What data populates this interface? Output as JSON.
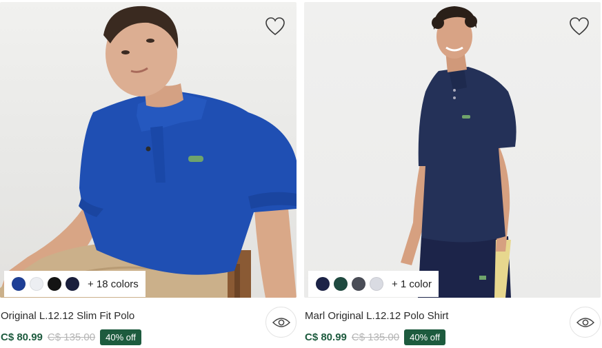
{
  "products": [
    {
      "name": "Original L.12.12 Slim Fit Polo",
      "price": "C$ 80.99",
      "original_price": "C$ 135.00",
      "discount_badge": "40% off",
      "more_colors": "+ 18 colors",
      "swatches": [
        "#1e3f96",
        "#eceef2",
        "#141414",
        "#1a1f3d"
      ],
      "shirt_color": "#1f4fb3"
    },
    {
      "name": "Marl Original L.12.12 Polo Shirt",
      "price": "C$ 80.99",
      "original_price": "C$ 135.00",
      "discount_badge": "40% off",
      "more_colors": "+ 1 color",
      "swatches": [
        "#1c2347",
        "#1f4a40",
        "#4a4d57",
        "#d9dbe2"
      ],
      "shirt_color": "#243158"
    }
  ],
  "icons": {
    "wishlist": "heart-outline-icon",
    "quick_view": "eye-icon"
  },
  "colors": {
    "brand_green": "#1d5b3e",
    "strike_gray": "#b4b4b4"
  }
}
